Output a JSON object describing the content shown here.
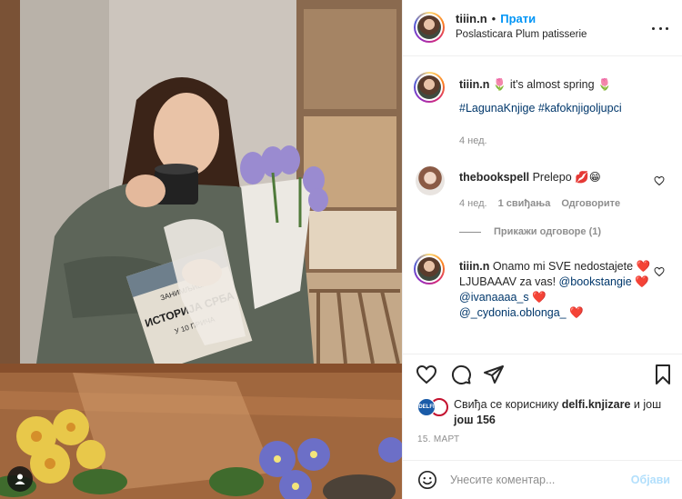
{
  "post": {
    "username": "tiiin.n",
    "follow_label": "Прати",
    "location": "Poslasticara Plum patisserie"
  },
  "caption": {
    "username": "tiiin.n",
    "text": "🌷 it's almost spring 🌷",
    "hashtags": "#LagunaKnjige #kafoknjigoljupci",
    "time": "4 нед."
  },
  "comments": [
    {
      "username": "thebookspell",
      "text": "Prelepo 💋😁",
      "time": "4 нед.",
      "likes": "1 свиђања",
      "reply_label": "Одговорите",
      "view_replies": "Прикажи одговоре (1)"
    },
    {
      "username": "tiiin.n",
      "text_1": "Onamo mi SVE nedostajete",
      "heart_1": "❤️",
      "text_2": "LJUBAAAV za vas!",
      "mention_1": "@bookstangie",
      "heart_2": "❤️",
      "mention_2": "@ivanaaaa_s",
      "heart_3": "❤️",
      "mention_3": "@_cydonia.oblonga_",
      "heart_4": "❤️"
    }
  ],
  "liked_by": {
    "avatar_label": "DELFI",
    "prefix": "Свиђа се кориснику",
    "user": "delfi.knjizare",
    "middle": "и још",
    "count": "још 156"
  },
  "date": "15. МАРТ",
  "add_comment": {
    "placeholder": "Унесите коментар...",
    "post_label": "Објави"
  },
  "photo": {
    "book_title": "ИСТОРИЈА СРБА",
    "book_subtitle": "У 10 ПРИЧА",
    "book_top": "ЗАНИМЉИВА"
  },
  "colors": {
    "accent": "#0095f6",
    "mention": "#00376b",
    "muted": "#8e8e8e",
    "post_disabled": "#b2dffc",
    "heart": "#ed4956"
  }
}
